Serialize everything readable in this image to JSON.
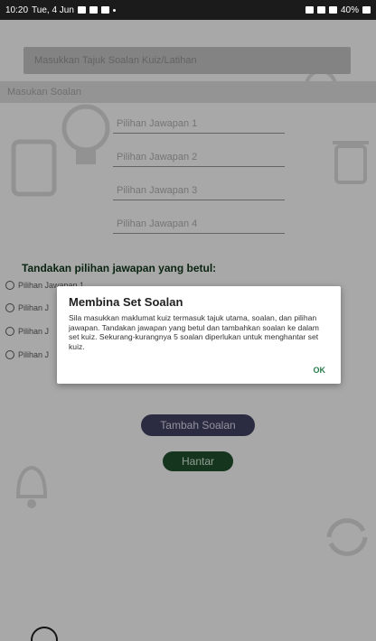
{
  "status_bar": {
    "time": "10:20",
    "date": "Tue, 4 Jun",
    "battery": "40%"
  },
  "form": {
    "title_placeholder": "Masukkan Tajuk Soalan Kuiz/Latihan",
    "question_placeholder": "Masukan Soalan",
    "answers": [
      "Pilihan Jawapan 1",
      "Pilihan Jawapan 2",
      "Pilihan Jawapan 3",
      "Pilihan Jawapan 4"
    ],
    "mark_heading": "Tandakan pilihan jawapan yang betul:",
    "radio_options": [
      "Pilihan Jawapan 1",
      "Pilihan J",
      "Pilihan J",
      "Pilihan J"
    ]
  },
  "buttons": {
    "add_question": "Tambah Soalan",
    "submit": "Hantar"
  },
  "dialog": {
    "title": "Membina Set Soalan",
    "message": "Sila masukkan maklumat kuiz termasuk tajuk utama, soalan, dan pilihan jawapan. Tandakan jawapan yang betul dan tambahkan soalan ke dalam set kuiz. Sekurang-kurangnya 5 soalan diperlukan untuk menghantar set kuiz.",
    "ok_label": "OK"
  },
  "icons": {
    "back": "back-arrow-icon"
  },
  "colors": {
    "add_button": "#3c3c5c",
    "submit_button": "#1f4a2a",
    "heading_green": "#0f3318",
    "ok_text": "#2a7b4a"
  }
}
